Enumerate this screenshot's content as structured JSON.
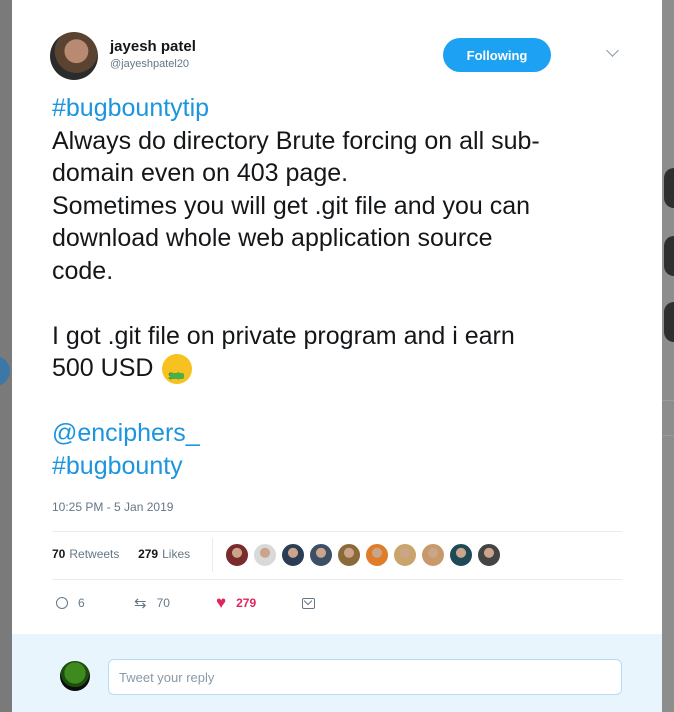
{
  "tweet": {
    "author_name": "jayesh patel",
    "author_handle": "@jayeshpatel20",
    "follow_label": "Following",
    "lines": [
      {
        "text": "#bugbountytip",
        "link": true
      },
      {
        "text": "Always do directory Brute forcing on all sub-",
        "link": false
      },
      {
        "text": "domain even on 403 page.",
        "link": false
      },
      {
        "text": "Sometimes you will get .git file and you can",
        "link": false
      },
      {
        "text": "download whole web application source",
        "link": false
      },
      {
        "text": "code.",
        "link": false
      },
      {
        "text": "",
        "link": false
      },
      {
        "text": "I got .git file on private program and i earn",
        "link": false
      },
      {
        "text": "500 USD",
        "link": false,
        "emoji": "money-mouth-face"
      },
      {
        "text": "",
        "link": false
      },
      {
        "text": "@enciphers_",
        "link": true
      },
      {
        "text": "#bugbounty",
        "link": true
      }
    ],
    "timestamp": "10:25 PM - 5 Jan 2019"
  },
  "stats": {
    "retweets_count": "70",
    "retweets_label": "Retweets",
    "likes_count": "279",
    "likes_label": "Likes",
    "liker_avatar_colors": [
      "#7a2b2b",
      "#d9d9d9",
      "#2b3d55",
      "#3d4f66",
      "#8a6a3a",
      "#e07d2a",
      "#c9a56b",
      "#c89a6a",
      "#1e4a57",
      "#444444"
    ]
  },
  "actions": {
    "replies": "6",
    "retweets": "70",
    "likes": "279"
  },
  "reply": {
    "placeholder": "Tweet your reply"
  },
  "colors": {
    "accent": "#1da1f2",
    "link": "#1b95e0",
    "like": "#e0245e"
  }
}
